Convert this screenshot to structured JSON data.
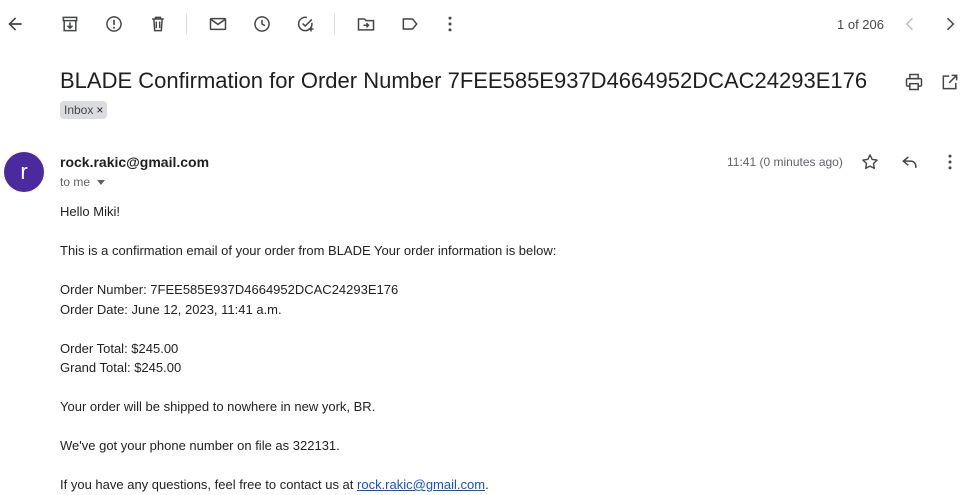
{
  "toolbar": {
    "counter": "1 of 206",
    "icons": [
      "back-icon",
      "archive-icon",
      "report-spam-icon",
      "delete-icon",
      "mark-unread-icon",
      "snooze-icon",
      "add-task-icon",
      "move-to-icon",
      "label-icon",
      "more-vert-icon",
      "prev-icon",
      "next-icon"
    ]
  },
  "email": {
    "subject": "BLADE Confirmation for Order Number 7FEE585E937D4664952DCAC24293E176",
    "label": "Inbox",
    "label_remove": "×",
    "avatar_letter": "r",
    "sender": "rock.rakic@gmail.com",
    "to": "to me",
    "time": "11:41 (0 minutes ago)",
    "body": {
      "greeting": "Hello Miki!",
      "intro": "This is a confirmation email of your order from BLADE Your order information is below:",
      "order_number": "Order Number: 7FEE585E937D4664952DCAC24293E176",
      "order_date": "Order Date: June 12, 2023, 11:41 a.m.",
      "order_total": "Order Total: $245.00",
      "grand_total": "Grand Total: $245.00",
      "shipping": "Your order will be shipped to nowhere in new york, BR.",
      "phone": "We've got your phone number on file as 322131.",
      "contact_prefix": "If you have any questions, feel free to contact us at ",
      "contact_link": "rock.rakic@gmail.com",
      "contact_suffix": "."
    }
  },
  "colors": {
    "avatar": "#4a2a9e",
    "link": "#1155cc",
    "chip": "#dadce0"
  }
}
